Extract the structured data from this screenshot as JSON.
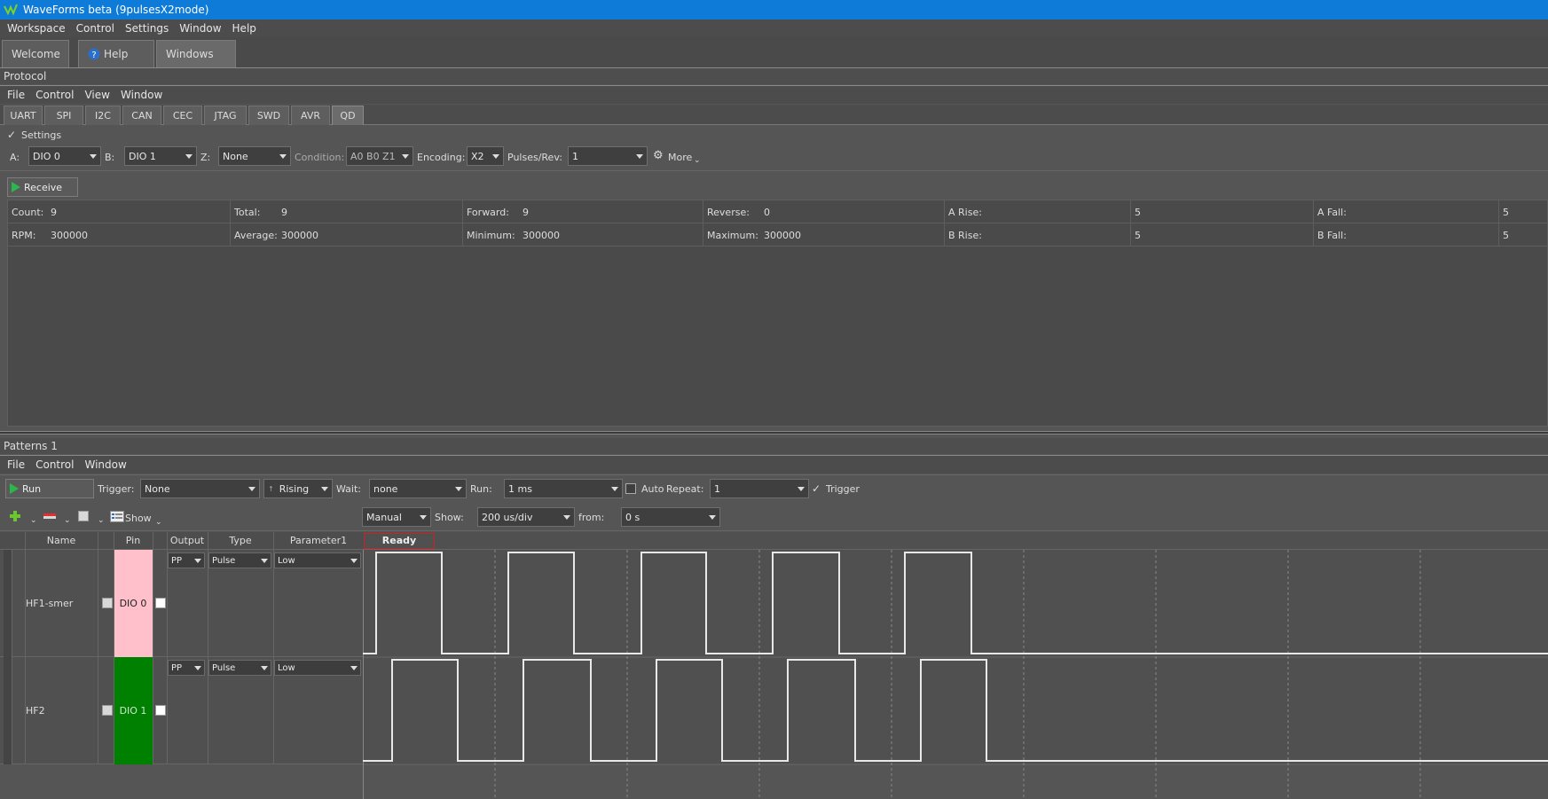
{
  "app": {
    "title": "WaveForms beta (9pulsesX2mode)"
  },
  "main_menu": [
    "Workspace",
    "Control",
    "Settings",
    "Window",
    "Help"
  ],
  "workspace_tabs": [
    {
      "label": "Welcome"
    },
    {
      "label": "Help"
    },
    {
      "label": "Windows"
    }
  ],
  "protocol": {
    "title": "Protocol",
    "menu": [
      "File",
      "Control",
      "View",
      "Window"
    ],
    "tabs": [
      "UART",
      "SPI",
      "I2C",
      "CAN",
      "CEC",
      "JTAG",
      "SWD",
      "AVR",
      "QD"
    ],
    "active_tab": "QD",
    "settings_label": "Settings",
    "a_label": "A:",
    "a_value": "DIO 0",
    "b_label": "B:",
    "b_value": "DIO 1",
    "z_label": "Z:",
    "z_value": "None",
    "condition_label": "Condition:",
    "condition_value": "A0 B0 Z1",
    "encoding_label": "Encoding:",
    "encoding_value": "X2",
    "pulses_label": "Pulses/Rev:",
    "pulses_value": "1",
    "more_label": "More",
    "receive_label": "Receive",
    "stats": {
      "row1": [
        {
          "label": "Count:",
          "value": "9"
        },
        {
          "label": "Total:",
          "value": "9"
        },
        {
          "label": "Forward:",
          "value": "9"
        },
        {
          "label": "Reverse:",
          "value": "0"
        },
        {
          "label": "A Rise:",
          "value": "5"
        },
        {
          "label": "A Fall:",
          "value": "5"
        }
      ],
      "row2": [
        {
          "label": "RPM:",
          "value": "300000"
        },
        {
          "label": "Average:",
          "value": "300000"
        },
        {
          "label": "Minimum:",
          "value": "300000"
        },
        {
          "label": "Maximum:",
          "value": "300000"
        },
        {
          "label": "B Rise:",
          "value": "5"
        },
        {
          "label": "B Fall:",
          "value": "5"
        }
      ]
    }
  },
  "patterns": {
    "title": "Patterns 1",
    "menu": [
      "File",
      "Control",
      "Window"
    ],
    "run_label": "Run",
    "trigger_label": "Trigger:",
    "trigger_value": "None",
    "edge_value": "Rising",
    "wait_label": "Wait:",
    "wait_value": "none",
    "run_time_label": "Run:",
    "run_time_value": "1 ms",
    "auto_label": "Auto",
    "repeat_label": "Repeat:",
    "repeat_value": "1",
    "trigger_check_label": "Trigger",
    "show_btn_label": "Show",
    "mode_value": "Manual",
    "show_label": "Show:",
    "show_value": "200 us/div",
    "from_label": "from:",
    "from_value": "0 s",
    "status": "Ready",
    "columns": [
      "Name",
      "Pin",
      "Output",
      "Type",
      "Parameter1"
    ],
    "rows": [
      {
        "name": "HF1-smer",
        "pin": "DIO 0",
        "output": "PP",
        "type": "Pulse",
        "param": "Low",
        "pin_color": "#ffc0cb"
      },
      {
        "name": "HF2",
        "pin": "DIO 1",
        "output": "PP",
        "type": "Pulse",
        "param": "Low",
        "pin_color": "#008000"
      }
    ]
  },
  "colors": {
    "titlebar": "#0e7bd8",
    "run_green": "#2bb84a",
    "ready_border": "#cc2222"
  }
}
